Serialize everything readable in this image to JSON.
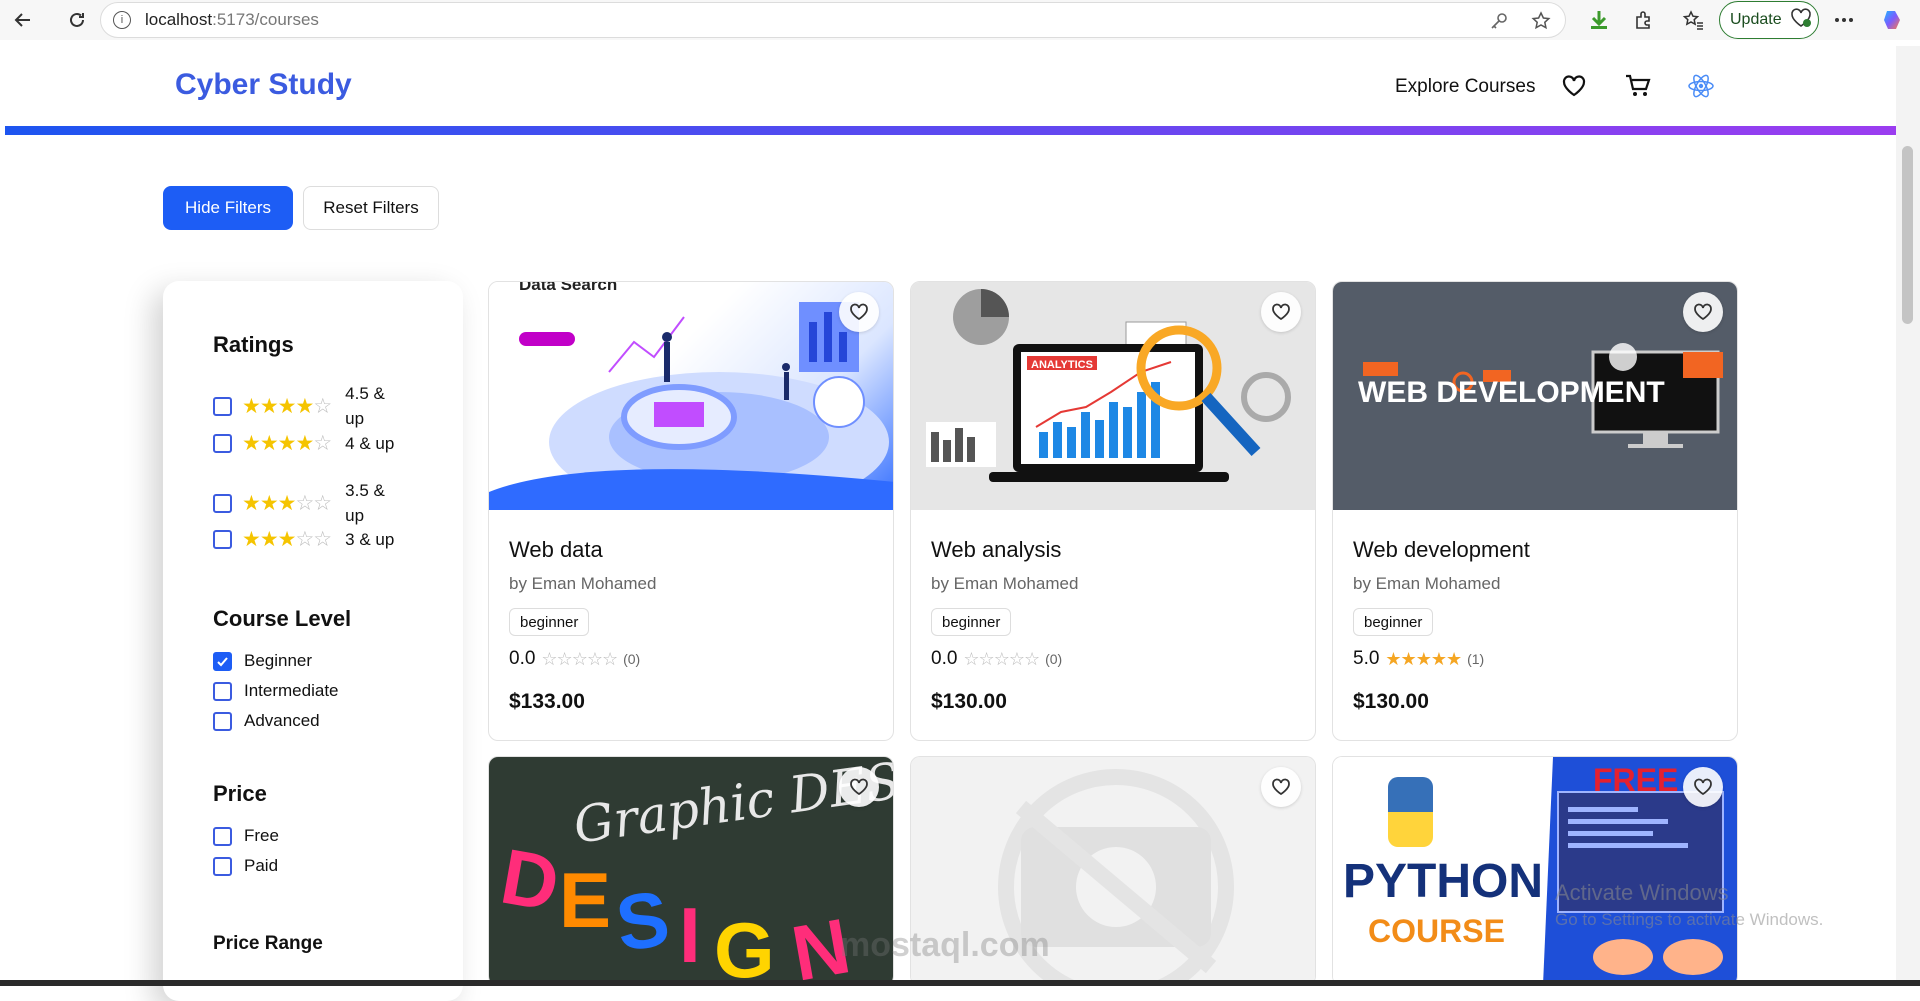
{
  "browser": {
    "url_host": "localhost",
    "url_rest": ":5173/courses",
    "update_label": "Update"
  },
  "header": {
    "logo": "Cyber Study",
    "explore": "Explore Courses"
  },
  "buttons": {
    "hide_filters": "Hide Filters",
    "reset_filters": "Reset Filters"
  },
  "filters": {
    "ratings_title": "Ratings",
    "ratings": [
      {
        "label": "4.5 & up",
        "stars": 4.5
      },
      {
        "label": "4 & up",
        "stars": 4
      },
      {
        "label": "3.5 & up",
        "stars": 3.5
      },
      {
        "label": "3 & up",
        "stars": 3
      }
    ],
    "level_title": "Course Level",
    "levels": [
      {
        "label": "Beginner",
        "checked": true
      },
      {
        "label": "Intermediate",
        "checked": false
      },
      {
        "label": "Advanced",
        "checked": false
      }
    ],
    "price_title": "Price",
    "prices": [
      {
        "label": "Free"
      },
      {
        "label": "Paid"
      }
    ],
    "range_title": "Price Range"
  },
  "courses": [
    {
      "title": "Web data",
      "author": "by Eman Mohamed",
      "level": "beginner",
      "rating": "0.0",
      "count": "(0)",
      "price": "$133.00",
      "image": "Data Search",
      "stars": 0
    },
    {
      "title": "Web analysis",
      "author": "by Eman Mohamed",
      "level": "beginner",
      "rating": "0.0",
      "count": "(0)",
      "price": "$130.00",
      "image": "ANALYTICS",
      "stars": 0
    },
    {
      "title": "Web development",
      "author": "by Eman Mohamed",
      "level": "beginner",
      "rating": "5.0",
      "count": "(1)",
      "price": "$130.00",
      "image": "WEB DEVELOPMENT",
      "stars": 5
    },
    {
      "image": "Graphic DESIGN"
    },
    {
      "image": ""
    },
    {
      "image_top": "FREE",
      "image_main": "PYTHON",
      "image_sub": "COURSE"
    }
  ],
  "watermark": {
    "line1": "Activate Windows",
    "line2": "Go to Settings to activate Windows.",
    "site": "mostaql.com"
  },
  "colors": {
    "brand": "#3b5be0",
    "primary": "#1d5df5",
    "star": "#f5c400",
    "gradient_end": "#9b3df0"
  }
}
